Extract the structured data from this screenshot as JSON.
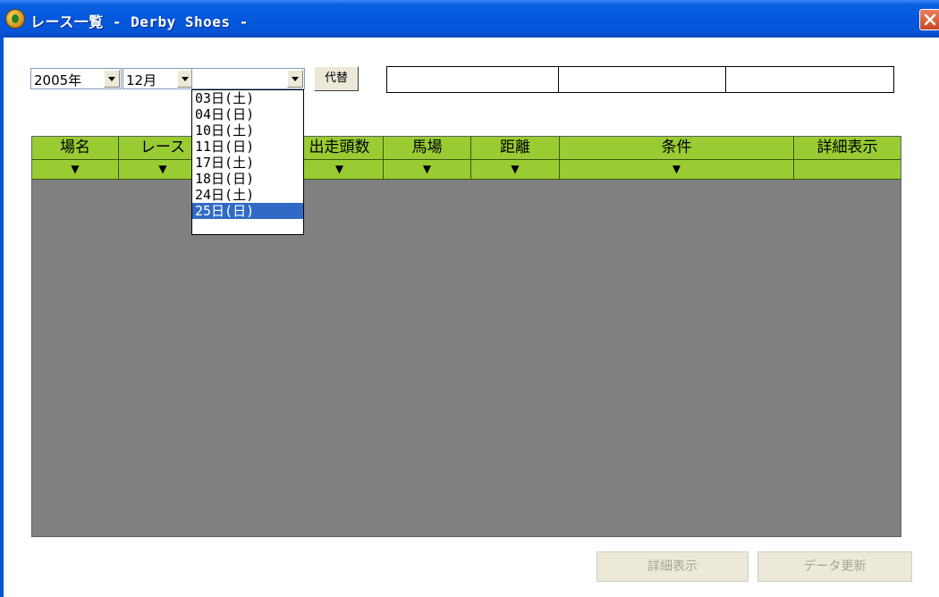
{
  "window": {
    "title": "レース一覧 - Derby Shoes -"
  },
  "filters": {
    "year": "2005年",
    "month": "12月",
    "day": "",
    "alt_button": "代替"
  },
  "day_options": [
    "03日(土)",
    "04日(日)",
    "10日(土)",
    "11日(日)",
    "17日(土)",
    "18日(日)",
    "24日(土)",
    "25日(日)"
  ],
  "day_selected_index": 7,
  "info_boxes": [
    "",
    "",
    ""
  ],
  "table": {
    "columns": [
      "場名",
      "レース",
      "",
      "出走頭数",
      "馬場",
      "距離",
      "条件",
      "詳細表示"
    ],
    "filter_marks": [
      "▼",
      "▼",
      "",
      "▼",
      "▼",
      "▼",
      "▼",
      ""
    ]
  },
  "actions": {
    "detail_label": "詳細表示",
    "refresh_label": "データ更新"
  }
}
